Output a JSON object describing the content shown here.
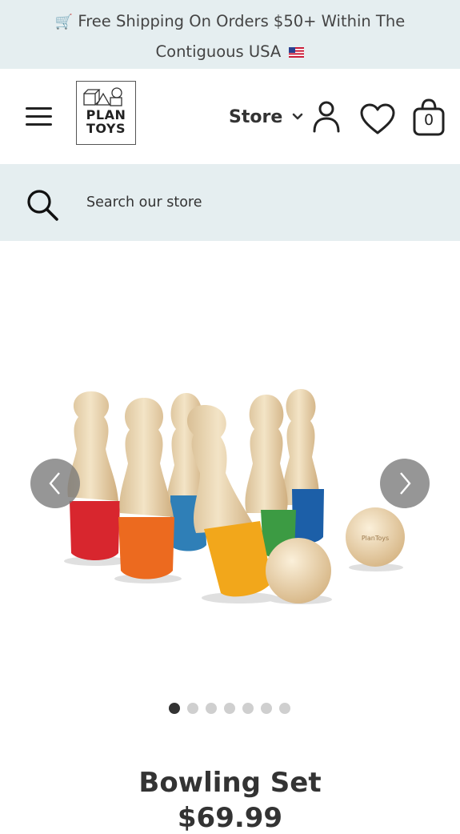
{
  "announcement": {
    "icon": "shopping-cart-icon",
    "text": "Free Shipping On Orders $50+ Within The Contiguous USA",
    "flag": "us-flag-icon"
  },
  "header": {
    "menu_icon": "hamburger-menu-icon",
    "logo": {
      "line1": "PLAN",
      "line2": "TOYS"
    },
    "store_label": "Store",
    "account_icon": "user-icon",
    "wishlist_icon": "heart-icon",
    "cart_count": "0"
  },
  "search": {
    "placeholder": "Search our store",
    "icon": "search-icon"
  },
  "gallery": {
    "image": "bowling-set-product-photo",
    "ball_imprint": "PlanToys",
    "slide_count": 7,
    "active_slide": 1
  },
  "product": {
    "title": "Bowling Set",
    "price": "$69.99"
  },
  "colors": {
    "banner_bg": "#e5eef0",
    "text": "#333333",
    "arrow_bg": "#7a7a7a"
  }
}
